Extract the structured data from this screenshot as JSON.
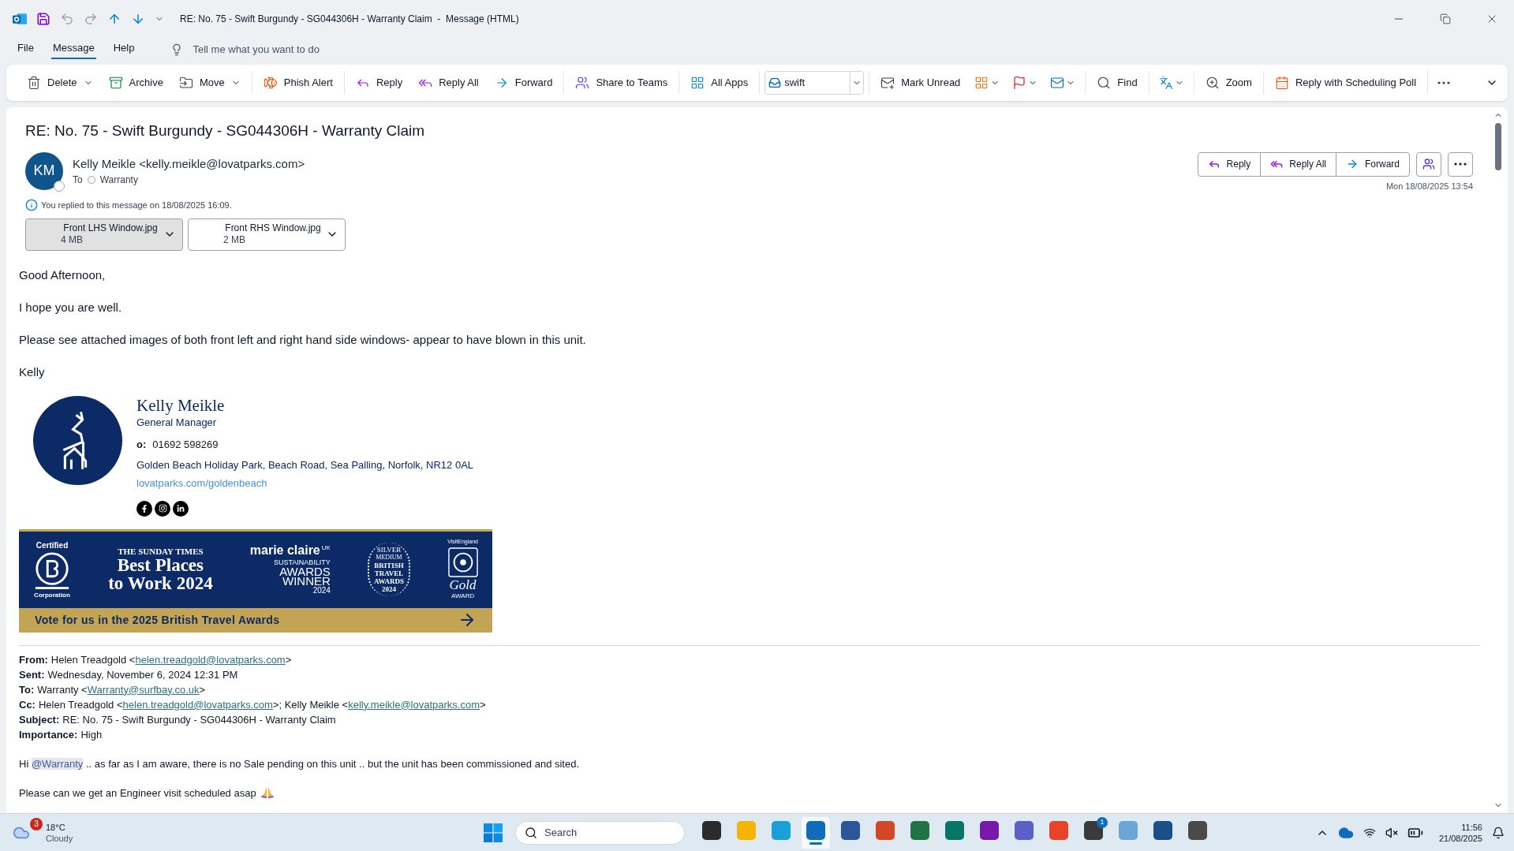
{
  "window": {
    "title": "RE: No. 75 - Swift Burgundy - SG044306H - Warranty Claim  -  Message (HTML)"
  },
  "menu": {
    "tabs": [
      {
        "label": "File",
        "selected": false
      },
      {
        "label": "Message",
        "selected": true
      },
      {
        "label": "Help",
        "selected": false
      }
    ],
    "search": {
      "placeholder": "Tell me what you want to do"
    }
  },
  "ribbon": {
    "groups": [
      [
        {
          "kind": "button",
          "label": "Delete",
          "caret": true
        },
        {
          "kind": "button",
          "label": "Archive",
          "caret": false
        },
        {
          "kind": "button",
          "label": "Move",
          "caret": true
        }
      ],
      [
        {
          "kind": "button",
          "label": "Phish Alert",
          "caret": false
        }
      ],
      [
        {
          "kind": "button",
          "label": "Reply",
          "caret": false
        },
        {
          "kind": "button",
          "label": "Reply All",
          "caret": false
        },
        {
          "kind": "button",
          "label": "Forward",
          "caret": false
        }
      ],
      [
        {
          "kind": "button",
          "label": "Share to Teams",
          "caret": false
        }
      ],
      [
        {
          "kind": "button",
          "label": "All Apps",
          "caret": false
        }
      ],
      [
        {
          "kind": "combo",
          "value": "swift"
        }
      ],
      [
        {
          "kind": "button",
          "label": "Mark Unread",
          "caret": false
        },
        {
          "kind": "icon",
          "caret": true
        },
        {
          "kind": "icon",
          "caret": true
        },
        {
          "kind": "icon",
          "caret": true
        }
      ],
      [
        {
          "kind": "button",
          "label": "Find",
          "caret": false
        }
      ],
      [
        {
          "kind": "icon",
          "caret": true
        }
      ],
      [
        {
          "kind": "button",
          "label": "Zoom",
          "caret": false
        }
      ],
      [
        {
          "kind": "button",
          "label": "Reply with Scheduling Poll",
          "caret": false
        }
      ],
      [
        {
          "kind": "icon",
          "caret": false
        }
      ]
    ]
  },
  "message": {
    "subject": "RE: No. 75 - Swift Burgundy - SG044306H - Warranty Claim",
    "avatar": "KM",
    "sender": "Kelly Meikle <kelly.meikle@lovatparks.com>",
    "to_label": "To",
    "to": "Warranty",
    "info": "You replied to this message on 18/08/2025 16:09.",
    "actions": [
      "Reply",
      "Reply All",
      "Forward"
    ],
    "date": "Mon 18/08/2025 13:54",
    "attachments": [
      {
        "name": "Front LHS Window.jpg",
        "size": "4 MB",
        "selected": true
      },
      {
        "name": "Front RHS Window.jpg",
        "size": "2 MB",
        "selected": false
      }
    ],
    "body": [
      "Good Afternoon,",
      "I hope you are well.",
      "Please see attached images of both front left and right hand side windows- appear to have blown in this unit.",
      "Kelly"
    ],
    "signature": {
      "name": "Kelly Meikle",
      "role": "General Manager",
      "phone_label": "o:",
      "phone": "01692 598269",
      "address": "Golden Beach Holiday Park, Beach Road, Sea Palling, Norfolk, NR12 0AL",
      "link": "lovatparks.com/goldenbeach"
    },
    "banner": {
      "certified": "Certified",
      "corporation": "Corporation",
      "times": "THE SUNDAY TIMES",
      "best": "Best Places",
      "work": "to Work 2024",
      "mc": "marie claire",
      "mc_uk": "UK",
      "mc_lines": [
        "SUSTAINABILITY",
        "AWARDS",
        "WINNER",
        "2024"
      ],
      "silver": "SILVER",
      "medium": "MEDIUM",
      "bta": [
        "BRITISH",
        "TRAVEL",
        "AWARDS",
        "2024"
      ],
      "ve": "VisitEngland",
      "gold": "Gold",
      "award": "AWARD",
      "vote": "Vote for us in the 2025 British Travel Awards"
    },
    "forwarded": [
      {
        "label": "From:",
        "parts": [
          {
            "kind": "text",
            "text": "Helen Treadgold <"
          },
          {
            "kind": "link",
            "text": "helen.treadgold@lovatparks.com"
          },
          {
            "kind": "text",
            "text": ">"
          }
        ]
      },
      {
        "label": "Sent:",
        "parts": [
          {
            "kind": "text",
            "text": "Wednesday, November 6, 2024 12:31 PM"
          }
        ]
      },
      {
        "label": "To:",
        "parts": [
          {
            "kind": "text",
            "text": "Warranty <"
          },
          {
            "kind": "link",
            "text": "Warranty@surfbay.co.uk"
          },
          {
            "kind": "text",
            "text": ">"
          }
        ]
      },
      {
        "label": "Cc:",
        "parts": [
          {
            "kind": "text",
            "text": "Helen Treadgold <"
          },
          {
            "kind": "link",
            "text": "helen.treadgold@lovatparks.com"
          },
          {
            "kind": "text",
            "text": ">; Kelly Meikle <"
          },
          {
            "kind": "link",
            "text": "kelly.meikle@lovatparks.com"
          },
          {
            "kind": "text",
            "text": ">"
          }
        ]
      },
      {
        "label": "Subject:",
        "parts": [
          {
            "kind": "text",
            "text": "RE: No. 75 - Swift Burgundy - SG044306H - Warranty Claim"
          }
        ]
      },
      {
        "label": "Importance:",
        "parts": [
          {
            "kind": "text",
            "text": "High"
          }
        ]
      }
    ],
    "reply": [
      [
        {
          "kind": "text",
          "text": "Hi "
        },
        {
          "kind": "mention",
          "text": "@Warranty"
        },
        {
          "kind": "text",
          "text": " .. as far as I am aware, there is no Sale pending on this unit .. but the unit has been commissioned and sited."
        }
      ],
      [
        {
          "kind": "text",
          "text": "Please can we get an Engineer visit scheduled asap"
        },
        {
          "kind": "emoji"
        }
      ]
    ]
  },
  "taskbar": {
    "weather": {
      "badge": "3",
      "temp": "18°C",
      "condition": "Cloudy"
    },
    "search": {
      "placeholder": "Search"
    },
    "apps": [
      {
        "color": "#2b2b2b",
        "selected": false
      },
      {
        "color": "#f4b400",
        "selected": false
      },
      {
        "color": "#1aa0d8",
        "selected": false
      },
      {
        "color": "#0f6cbd",
        "selected": true
      },
      {
        "color": "#2b579a",
        "selected": false
      },
      {
        "color": "#d24726",
        "selected": false
      },
      {
        "color": "#217346",
        "selected": false
      },
      {
        "color": "#077568",
        "selected": false
      },
      {
        "color": "#7719aa",
        "selected": false
      },
      {
        "color": "#5b5fc7",
        "selected": false
      },
      {
        "color": "#e8432b",
        "selected": false
      },
      {
        "color": "#3a3a3a",
        "selected": false,
        "badge": "1"
      },
      {
        "color": "#6aa7d8",
        "selected": false
      },
      {
        "color": "#1b4f8a",
        "selected": false
      },
      {
        "color": "#4a4a4a",
        "selected": false
      }
    ],
    "time": "11:56",
    "date": "21/08/2025"
  }
}
